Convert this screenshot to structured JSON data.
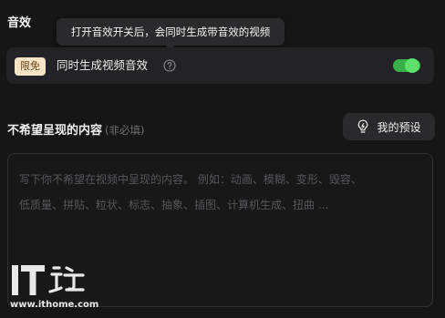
{
  "section": {
    "title": "音效"
  },
  "tooltip": {
    "text": "打开音效开关后，会同时生成带音效的视频"
  },
  "sound_toggle": {
    "badge": "限免",
    "label": "同时生成视频音效",
    "enabled": true,
    "help_icon": "question-circle-icon",
    "accent_color": "#38b04a"
  },
  "exclude": {
    "title": "不希望呈现的内容",
    "optional_hint": "(非必填)",
    "preset_button_label": "我的预设",
    "preset_icon": "lightbulb-icon",
    "placeholder": "写下你不希望在视频中呈现的内容。 例如：动画、模糊、变形、毁容、\n低质量、拼贴、粒状、标志、抽象、插图、计算机生成、扭曲 ...",
    "value": ""
  },
  "watermark": {
    "logo": "IT之家",
    "url": "www.ithome.com"
  }
}
